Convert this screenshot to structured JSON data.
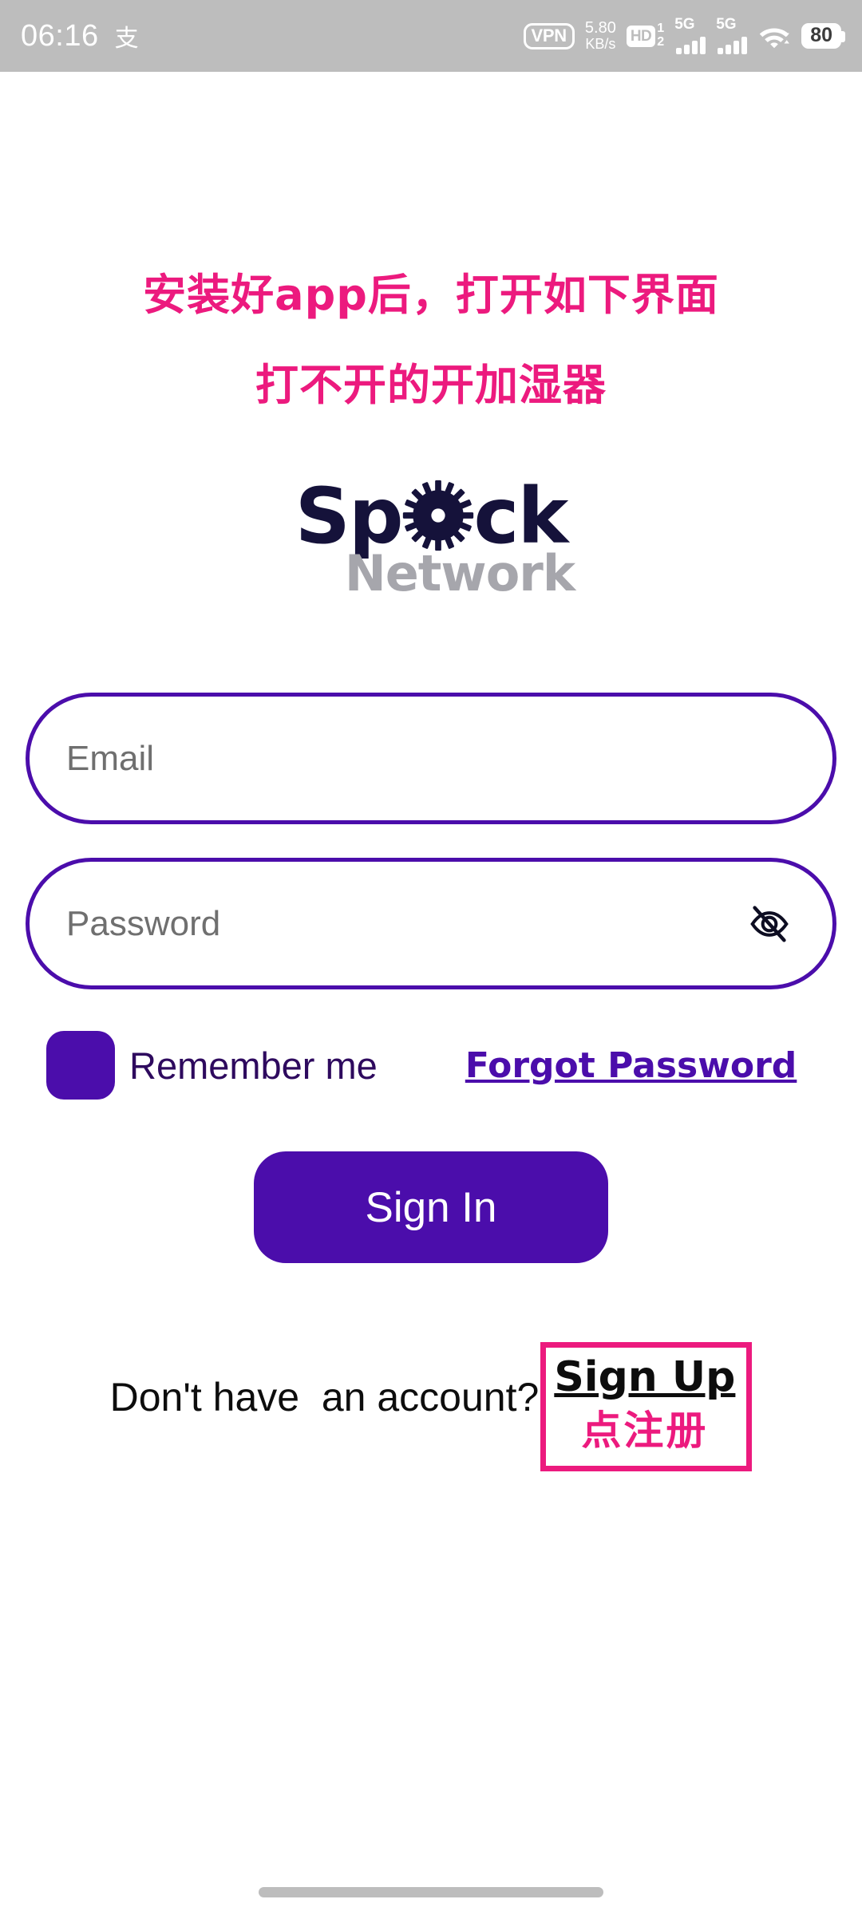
{
  "status_bar": {
    "time": "06:16",
    "alipay_glyph": "支",
    "vpn_label": "VPN",
    "net_speed_value": "5.80",
    "net_speed_unit": "KB/s",
    "hd_label": "HD",
    "hd_sub_top": "1",
    "hd_sub_bottom": "2",
    "sim1_network": "5G",
    "sim2_network": "5G",
    "battery_percent": "80",
    "background_color": "#bdbdbd"
  },
  "annotations": {
    "headline_line1": "安装好app后，打开如下界面",
    "headline_line2": "打不开的开加湿器",
    "signup_note": "点注册",
    "highlight_color": "#EC1A7E"
  },
  "logo": {
    "primary_text_before": "Sp",
    "primary_text_after": "ck",
    "secondary_text": "Network",
    "primary_color": "#15123a",
    "secondary_color": "#a6a6ac"
  },
  "form": {
    "email_placeholder": "Email",
    "email_value": "",
    "password_placeholder": "Password",
    "password_value": "",
    "remember_label": "Remember me",
    "forgot_label": "Forgot Password",
    "signin_label": "Sign In",
    "accent_color": "#4B0DAB"
  },
  "footer": {
    "prompt": "Don't have  an account?",
    "signup_label": "Sign Up"
  }
}
